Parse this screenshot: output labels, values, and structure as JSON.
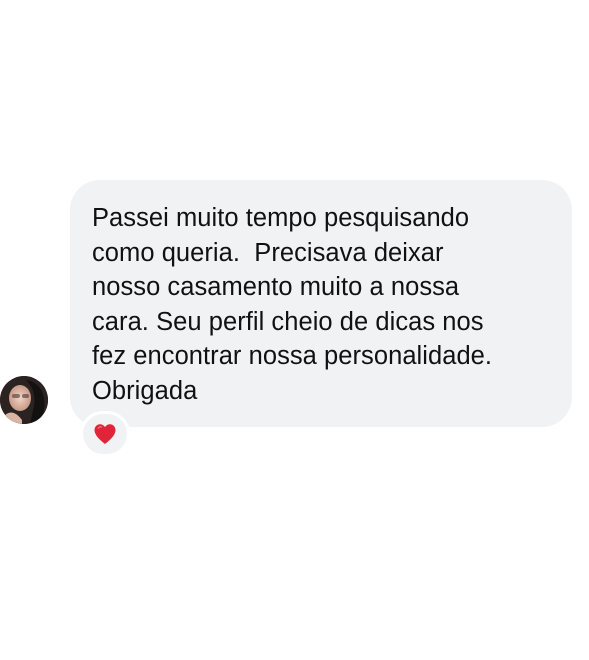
{
  "conversation": {
    "message": {
      "text": "Passei muito tempo pesquisando\ncomo queria.  Precisava deixar\nnosso casamento muito a nossa\ncara. Seu perfil cheio de dicas nos\nfez encontrar nossa personalidade.\nObrigada",
      "reaction_icon": "red-heart-icon",
      "bubble_color": "#f1f2f4"
    },
    "sender": {
      "avatar_icon": "profile-photo"
    }
  },
  "colors": {
    "background": "#ffffff",
    "heart": "#e0243a",
    "text": "#111111"
  }
}
